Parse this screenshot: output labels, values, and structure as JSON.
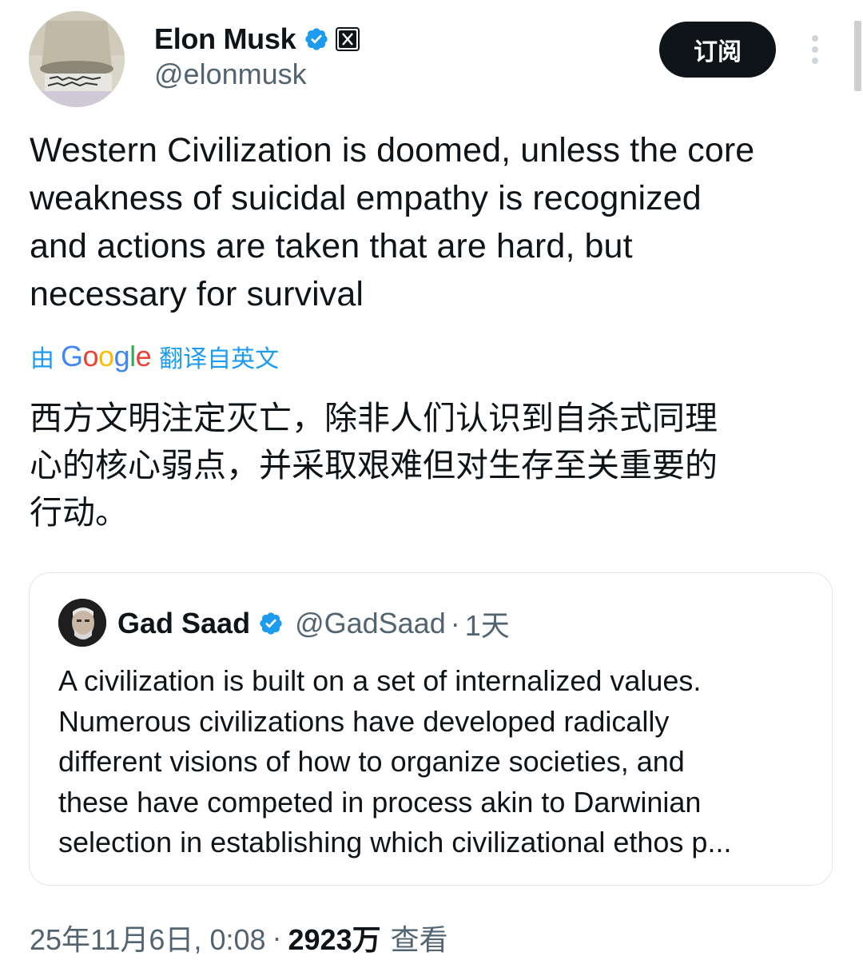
{
  "author": {
    "name": "Elon Musk",
    "handle": "@elonmusk"
  },
  "header": {
    "subscribe_label": "订阅"
  },
  "tweet": {
    "lines": [
      "Western Civilization is doomed, unless the core",
      "weakness of suicidal empathy is recognized",
      "and actions are taken that are hard, but",
      "necessary for survival"
    ],
    "translate_prefix": "由",
    "translate_brand": "Google",
    "translate_suffix": "翻译自英文",
    "translated_lines": [
      "西方文明注定灭亡，除非人们认识到自杀式同理",
      "心的核心弱点，并采取艰难但对生存至关重要的",
      "行动。"
    ]
  },
  "quote": {
    "name": "Gad Saad",
    "handle": "@GadSaad",
    "separator": "·",
    "time": "1天",
    "lines": [
      "A civilization is built on a set of internalized values.",
      "Numerous civilizations have developed radically",
      "different visions of how to organize societies, and",
      "these have competed in process akin to Darwinian",
      "selection in establishing which civilizational ethos p..."
    ]
  },
  "meta": {
    "datetime": "25年11月6日, 0:08",
    "separator": "·",
    "views_count": "2923万",
    "views_label": "查看"
  },
  "colors": {
    "verified_blue": "#1d9bf0",
    "text_primary": "#0f1419",
    "text_secondary": "#536471",
    "button_bg": "#0f1419",
    "card_border": "#e3e7eb"
  }
}
